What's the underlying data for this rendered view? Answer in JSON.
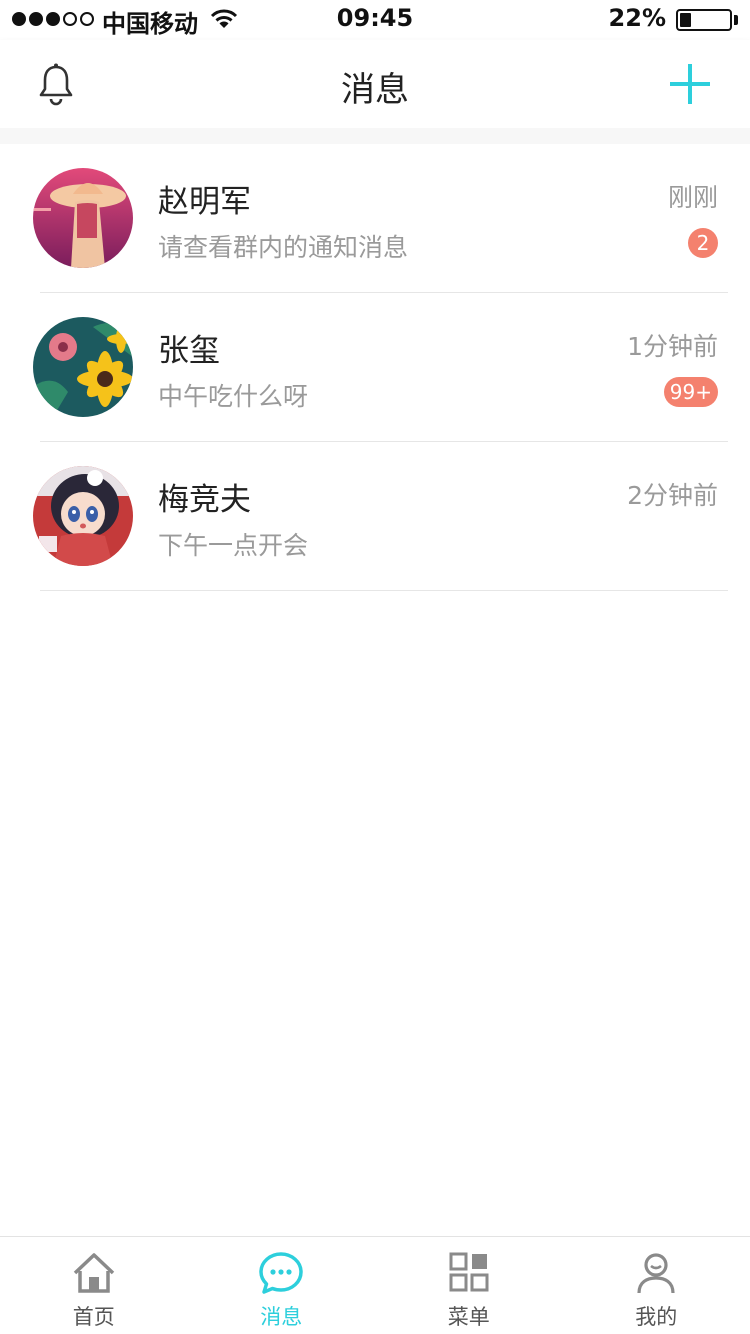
{
  "status_bar": {
    "carrier": "中国移动",
    "time": "09:45",
    "battery": "22%",
    "battery_level": 0.22,
    "signal_bars_filled": 3,
    "signal_bars_total": 5
  },
  "header": {
    "title": "消息",
    "left_icon": "bell-icon",
    "right_icon": "plus-icon"
  },
  "messages": [
    {
      "name": "赵明军",
      "preview": "请查看群内的通知消息",
      "time": "刚刚",
      "badge": "2"
    },
    {
      "name": "张玺",
      "preview": "中午吃什么呀",
      "time": "1分钟前",
      "badge": "99+"
    },
    {
      "name": "梅竞夫",
      "preview": "下午一点开会",
      "time": "2分钟前",
      "badge": ""
    }
  ],
  "tabbar": {
    "items": [
      {
        "label": "首页",
        "icon": "home-icon",
        "active": false
      },
      {
        "label": "消息",
        "icon": "chat-bubble-icon",
        "active": true
      },
      {
        "label": "菜单",
        "icon": "grid-menu-icon",
        "active": false
      },
      {
        "label": "我的",
        "icon": "person-icon",
        "active": false
      }
    ]
  },
  "colors": {
    "accent": "#2dcfdc",
    "badge": "#f4816e",
    "secondary_text": "#9a9a9a",
    "icon_gray": "#8a8a8a"
  }
}
